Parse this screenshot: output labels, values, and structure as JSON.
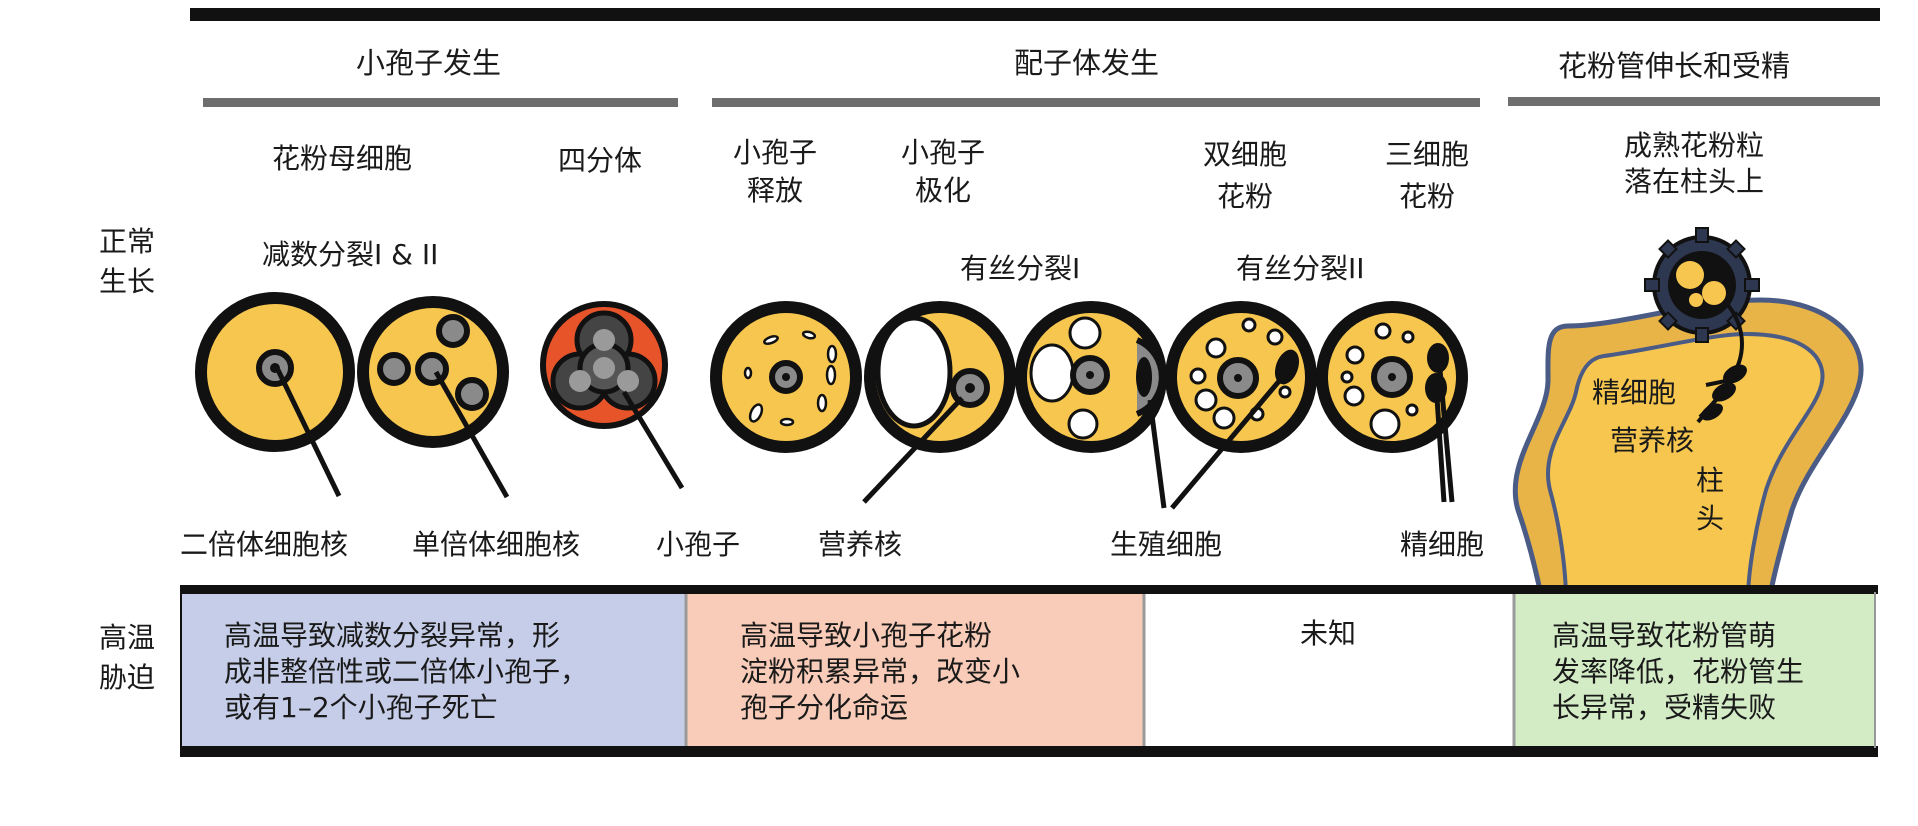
{
  "stages": {
    "microsporogenesis": "小孢子发生",
    "gametogenesis": "配子体发生",
    "fertilization": "花粉管伸长和受精"
  },
  "cell_labels": {
    "pmc": "花粉母细胞",
    "tetrad": "四分体",
    "release_1": "小孢子",
    "release_2": "释放",
    "polar_1": "小孢子",
    "polar_2": "极化",
    "bicell_1": "双细胞",
    "bicell_2": "花粉",
    "tricell_1": "三细胞",
    "tricell_2": "花粉",
    "mature_1": "成熟花粉粒",
    "mature_2": "落在柱头上"
  },
  "process_labels": {
    "meiosis": "减数分裂I & II",
    "mitosis1": "有丝分裂I",
    "mitosis2": "有丝分裂II"
  },
  "part_labels": {
    "diploid": "二倍体细胞核",
    "haploid": "单倍体细胞核",
    "microspore": "小孢子",
    "vegetative": "营养核",
    "generative": "生殖细胞",
    "sperm": "精细胞",
    "sperm_in_stigma": "精细胞",
    "veg_in_stigma": "营养核",
    "stigma_1": "柱",
    "stigma_2": "头"
  },
  "rows": {
    "normal_1": "正常",
    "normal_2": "生长",
    "heat_1": "高温",
    "heat_2": "胁迫"
  },
  "heat_effects": {
    "meiosis": "高温导致减数分裂异常，形\n成非整倍性或二倍体小孢子，\n或有1–2个小孢子死亡",
    "starch": "高温导致小孢子花粉\n淀粉积累异常，改变小\n孢子分化命运",
    "unknown": "未知",
    "tube": "高温导致花粉管萌\n发率降低，花粉管生\n长异常，受精失败"
  },
  "colors": {
    "cytoplasm": "#f7c64e",
    "tetrad_wall": "#e8542a",
    "nucleus": "#8a8a8a",
    "box_meiosis": "#c5cde8",
    "box_starch": "#f8ccb8",
    "box_unknown": "#ffffff",
    "box_tube": "#d3ecc6",
    "divider": "#6e6e6e",
    "stigma_border": "#4a5b86"
  }
}
